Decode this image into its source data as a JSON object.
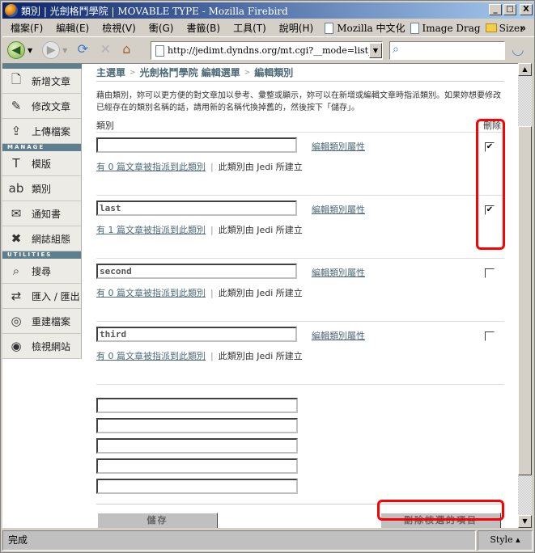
{
  "window": {
    "title": "類別 | 光劍格鬥學院 | MOVABLE TYPE - Mozilla Firebird",
    "minimize": "_",
    "maximize": "□",
    "close": "X"
  },
  "menubar": {
    "items": [
      "檔案(F)",
      "編輯(E)",
      "檢視(V)",
      "衝(G)",
      "書籤(B)",
      "工具(T)",
      "說明(H)"
    ],
    "bookmarks": [
      "Mozilla 中文化",
      "Image Drag",
      "Sizer"
    ],
    "more": "»"
  },
  "navbar": {
    "url": "http://jedimt.dyndns.org/mt.cgi?__mode=list_cat&b",
    "search_placeholder": ""
  },
  "sidebar": {
    "groups": [
      {
        "header": "",
        "items": [
          {
            "label": "新增文章",
            "icon": "new-document-icon"
          },
          {
            "label": "修改文章",
            "icon": "edit-document-icon"
          },
          {
            "label": "上傳檔案",
            "icon": "upload-folder-icon"
          }
        ]
      },
      {
        "header": "MANAGE",
        "items": [
          {
            "label": "模版",
            "icon": "template-icon"
          },
          {
            "label": "類別",
            "icon": "category-abc-icon"
          },
          {
            "label": "通知書",
            "icon": "envelope-icon"
          },
          {
            "label": "網誌組態",
            "icon": "tools-icon"
          }
        ]
      },
      {
        "header": "UTILITIES",
        "items": [
          {
            "label": "搜尋",
            "icon": "search-icon"
          },
          {
            "label": "匯入 / 匯出",
            "icon": "import-export-icon"
          },
          {
            "label": "重建檔案",
            "icon": "rebuild-target-icon"
          },
          {
            "label": "檢視網站",
            "icon": "view-site-eye-icon"
          }
        ]
      }
    ]
  },
  "main": {
    "breadcrumb": [
      "主選單",
      "光劍格鬥學院 編輯選單",
      "編輯類別"
    ],
    "breadcrumb_sep": ">",
    "intro": "藉由類別，妳可以更方便的對文章加以參考、彙整或顯示，妳可以在新增或編輯文章時指派類別。如果妳想要修改已經存在的類別名稱的話，請用新的名稱代換掉舊的，然後按下「儲存」。",
    "column_category": "類別",
    "column_delete": "刪除",
    "edit_link": "編輯類別屬性",
    "categories": [
      {
        "name": "",
        "assigned_link": "有 0 篇文章被指派到此類別",
        "created_by": "此類別由 Jedi 所建立",
        "checked": true
      },
      {
        "name": "last",
        "assigned_link": "有 1 篇文章被指派到此類別",
        "created_by": "此類別由 Jedi 所建立",
        "checked": true
      },
      {
        "name": "second",
        "assigned_link": "有 0 篇文章被指派到此類別",
        "created_by": "此類別由 Jedi 所建立",
        "checked": false
      },
      {
        "name": "third",
        "assigned_link": "有 0 篇文章被指派到此類別",
        "created_by": "此類別由 Jedi 所建立",
        "checked": false
      }
    ],
    "new_category_fields": [
      "",
      "",
      "",
      "",
      ""
    ],
    "save_label": "儲存",
    "delete_label": "刪除核選的項目"
  },
  "status": {
    "text": "完成",
    "style_label": "Style ▴"
  },
  "colors": {
    "sidebar_header": "#5e7f8f",
    "link": "#4d6a78",
    "highlight": "#ff0000"
  }
}
